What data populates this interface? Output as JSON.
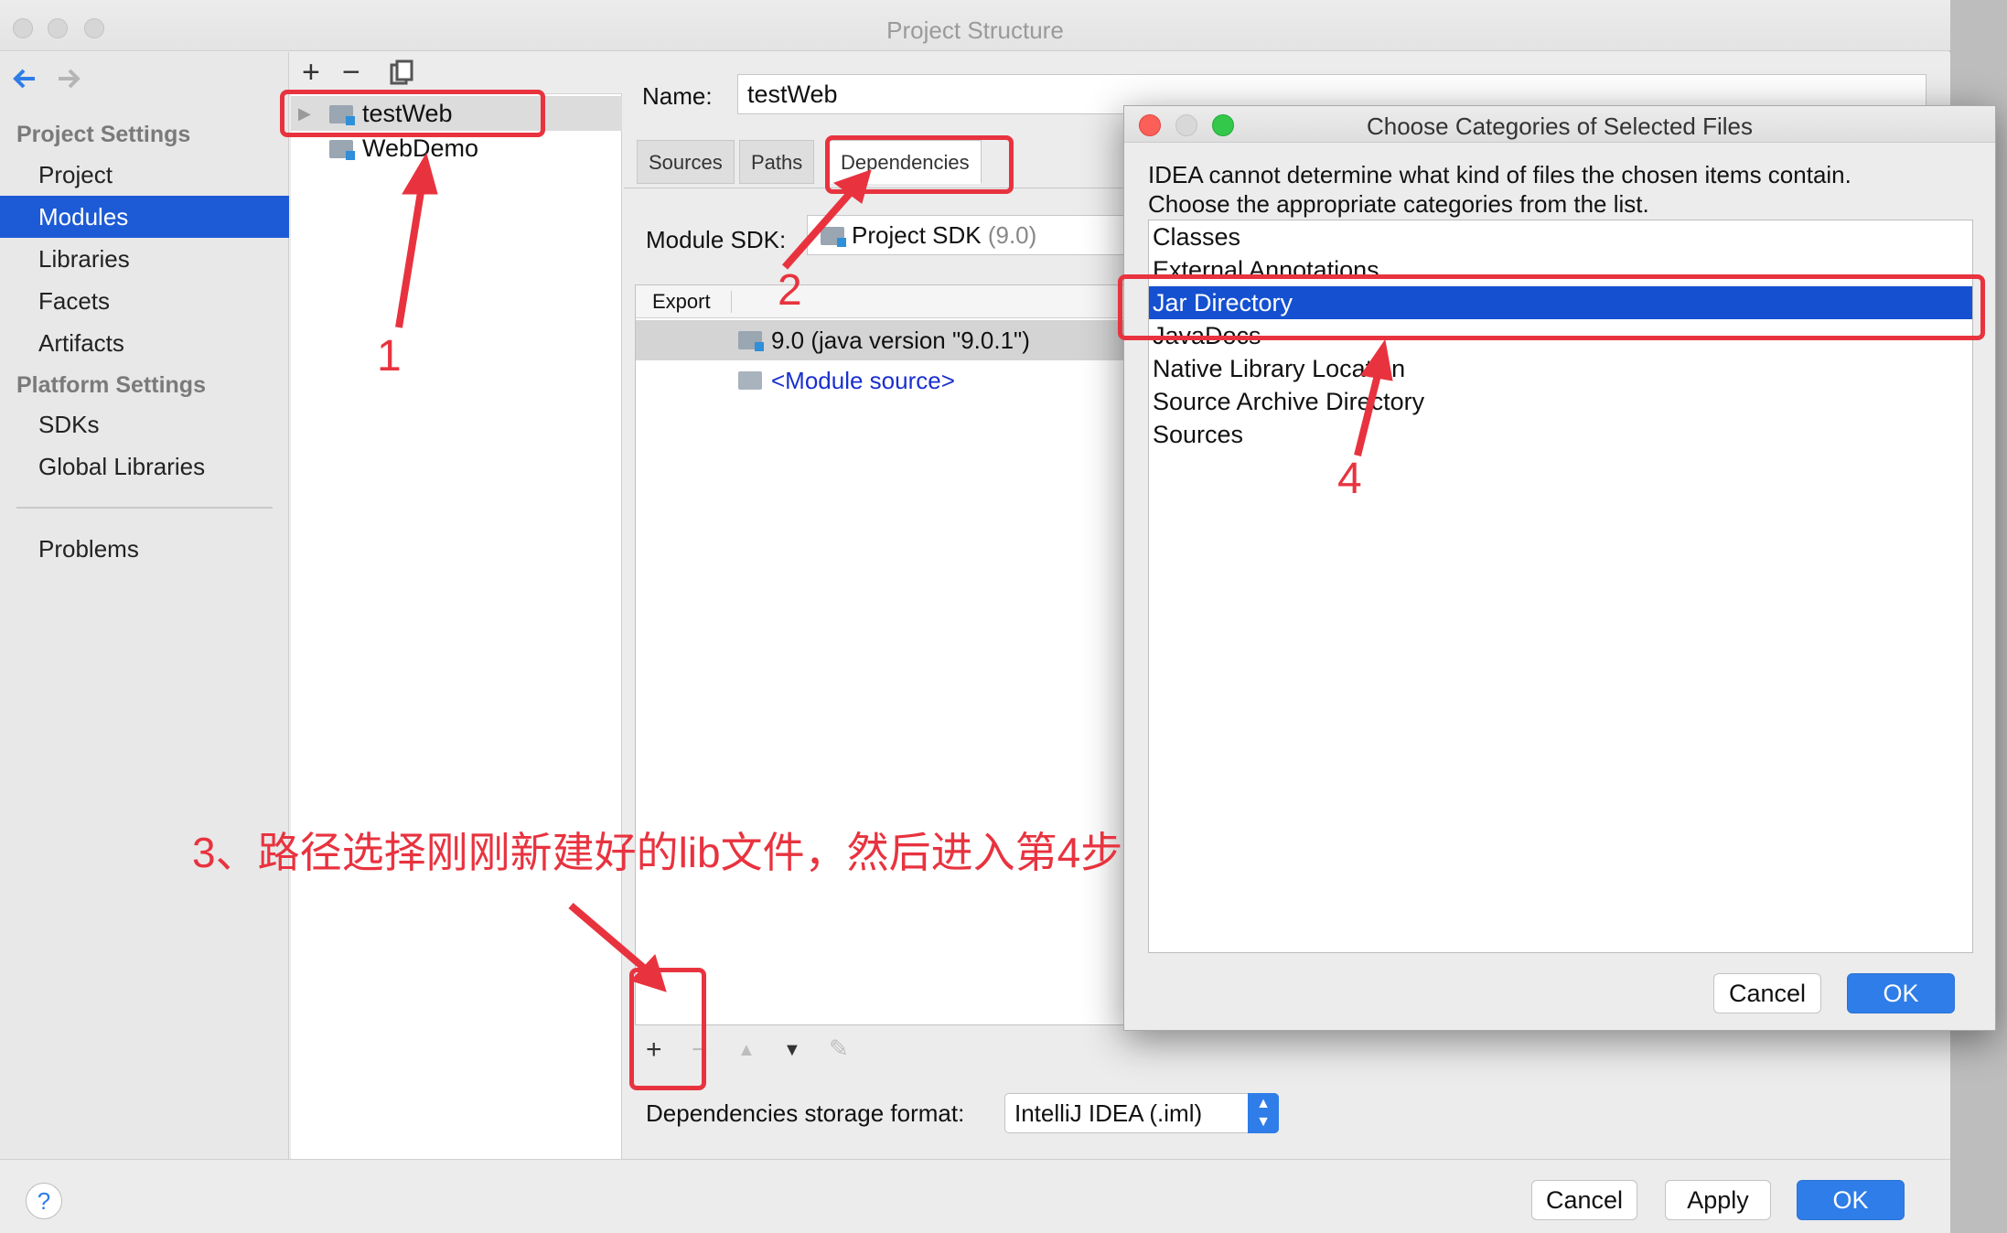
{
  "window": {
    "title": "Project Structure"
  },
  "nav": {
    "back_icon": "back-arrow-icon",
    "forward_icon": "forward-arrow-icon",
    "project_settings_header": "Project Settings",
    "items_project": [
      "Project",
      "Modules",
      "Libraries",
      "Facets",
      "Artifacts"
    ],
    "selected": "Modules",
    "platform_settings_header": "Platform Settings",
    "items_platform": [
      "SDKs",
      "Global Libraries"
    ],
    "problems": "Problems"
  },
  "tree": {
    "add_label": "+",
    "remove_label": "−",
    "modules": [
      "testWeb",
      "WebDemo"
    ]
  },
  "detail": {
    "name_label": "Name:",
    "name_value": "testWeb",
    "tabs": [
      "Sources",
      "Paths",
      "Dependencies"
    ],
    "active_tab": "Dependencies",
    "module_sdk_label": "Module SDK:",
    "module_sdk_value": "Project SDK",
    "module_sdk_version": "(9.0)",
    "table_header_export": "Export",
    "dependencies": [
      "9.0 (java version \"9.0.1\")",
      "<Module source>"
    ],
    "toolbar_add": "+",
    "toolbar_remove": "−",
    "toolbar_up": "▲",
    "toolbar_down": "▼",
    "toolbar_edit": "✎",
    "storage_format_label": "Dependencies storage format:",
    "storage_format_value": "IntelliJ IDEA (.iml)"
  },
  "bottom": {
    "help": "?",
    "cancel": "Cancel",
    "apply": "Apply",
    "ok": "OK"
  },
  "dialog": {
    "title": "Choose Categories of Selected Files",
    "message_line1": "IDEA cannot determine what kind of files the chosen items contain.",
    "message_line2": "Choose the appropriate categories from the list.",
    "categories": [
      "Classes",
      "External Annotations",
      "Jar Directory",
      "JavaDocs",
      "Native Library Location",
      "Source Archive Directory",
      "Sources"
    ],
    "selected_category": "Jar Directory",
    "cancel": "Cancel",
    "ok": "OK"
  },
  "annotations": {
    "step1": "1",
    "step2": "2",
    "step3_text": "3、路径选择刚刚新建好的lib文件，然后进入第4步",
    "step4": "4"
  },
  "colors": {
    "selection_blue": "#1d5bd6",
    "primary_button": "#2f7de8",
    "annotation_red": "#e8333f"
  }
}
